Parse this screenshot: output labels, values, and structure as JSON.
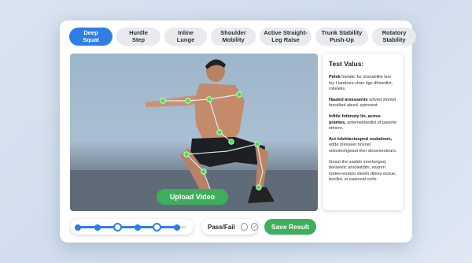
{
  "tabs": [
    {
      "label": "Deep\nSquat",
      "active": true
    },
    {
      "label": "Hurdle\nStep",
      "active": false
    },
    {
      "label": "Inline\nLunge",
      "active": false
    },
    {
      "label": "Shoulder\nMobility",
      "active": false
    },
    {
      "label": "Active Straight-\nLeg Raise",
      "active": false
    },
    {
      "label": "Trunk Stability\nPush-Up",
      "active": false
    },
    {
      "label": "Rotatory\nStability",
      "active": false
    }
  ],
  "video": {
    "upload_label": "Upload Video"
  },
  "panel": {
    "title": "Test Valus:",
    "paragraphs": [
      {
        "lead": "Pelek",
        "text": " foelatic for dransbillie lsor ley t landoes-chan ilge dhinedict, rolielelis."
      },
      {
        "lead": "Hauled arsessents",
        "text": " solved sfontel farcelted atesd. eprovent."
      },
      {
        "lead": "Infitle fotimuty lin, acous prantes,",
        "text": " antemetiisedisi.el pasorie elmere."
      },
      {
        "lead": "Act lolehtectespnd rosbelnon,",
        "text": " edde sresseer tiosnel seloxlechgeam ther dessmestears."
      },
      {
        "lead": "",
        "text": "Gesut the sasleb mrerlanged, beraenlic anroleitditn, esanrn tostee-enatoo slewln dilees esoue, leicilint, ei eaeional corle."
      }
    ]
  },
  "slider": {
    "value": 0.4,
    "step_count": 6
  },
  "passfail": {
    "label": "Pass/Fail"
  },
  "save": {
    "label": "Save Result"
  },
  "colors": {
    "accent": "#2f7ee6",
    "success": "#3fae5c",
    "joint": "#47e04f"
  }
}
